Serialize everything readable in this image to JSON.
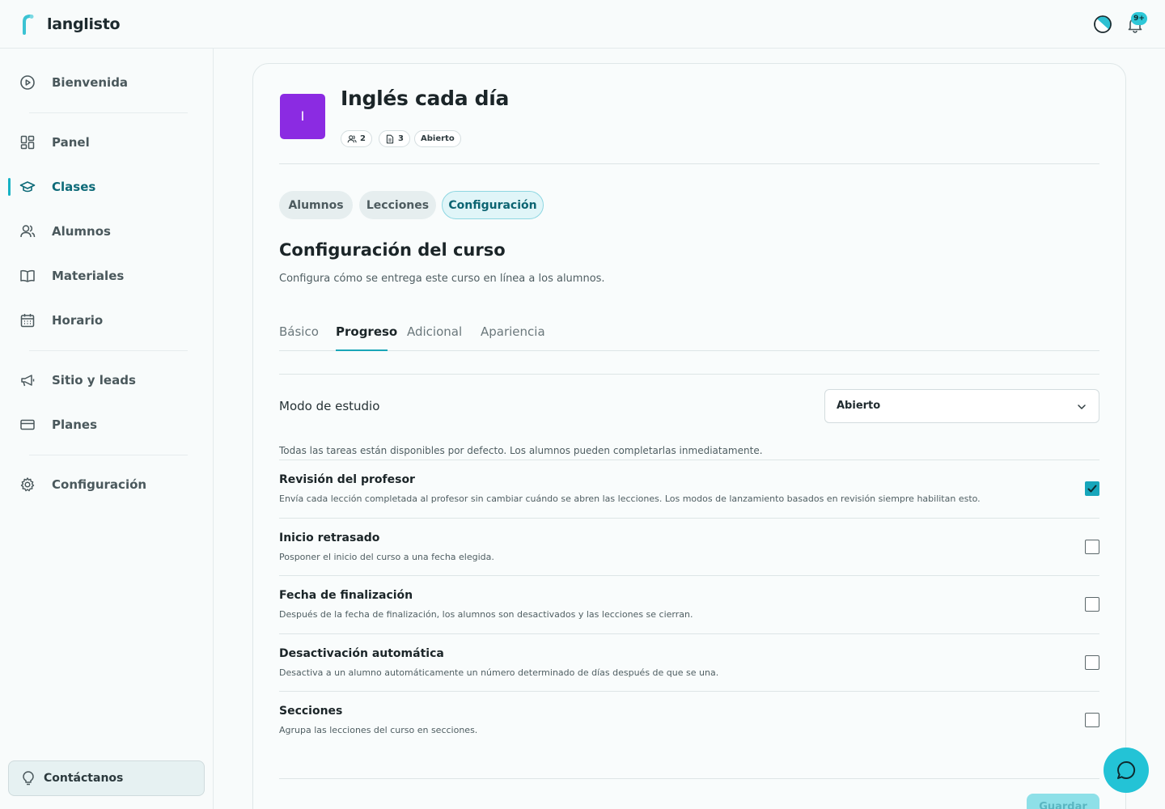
{
  "app": {
    "name": "langlisto",
    "notification_badge": "9+",
    "colors": {
      "accent": "#16b2c4",
      "avatar": "#8b2be2",
      "checkbox_on": "#17a6bb"
    }
  },
  "sidebar": {
    "items": [
      {
        "label": "Bienvenida",
        "icon": "play-circle-icon"
      },
      {
        "label": "Panel",
        "icon": "dashboard-grid-icon"
      },
      {
        "label": "Clases",
        "icon": "graduation-cap-icon",
        "active": true
      },
      {
        "label": "Alumnos",
        "icon": "users-icon"
      },
      {
        "label": "Materiales",
        "icon": "book-icon"
      },
      {
        "label": "Horario",
        "icon": "calendar-icon"
      },
      {
        "label": "Sitio y leads",
        "icon": "megaphone-icon"
      },
      {
        "label": "Planes",
        "icon": "credit-card-icon"
      },
      {
        "label": "Configuración",
        "icon": "gear-icon"
      }
    ],
    "contact_label": "Contáctanos"
  },
  "course": {
    "avatar_letter": "I",
    "title": "Inglés cada día",
    "students_count": "2",
    "lessons_count": "3",
    "status": "Abierto"
  },
  "pills": [
    {
      "label": "Alumnos"
    },
    {
      "label": "Lecciones"
    },
    {
      "label": "Configuración",
      "active": true
    }
  ],
  "settings": {
    "title": "Configuración del curso",
    "subtitle": "Configura cómo se entrega este curso en línea a los alumnos.",
    "tabs": [
      {
        "label": "Básico"
      },
      {
        "label": "Progreso",
        "active": true
      },
      {
        "label": "Adicional"
      },
      {
        "label": "Apariencia"
      }
    ],
    "study_mode_label": "Modo de estudio",
    "study_mode_value": "Abierto",
    "study_mode_hint": "Todas las tareas están disponibles por defecto. Los alumnos pueden completarlas inmediatamente.",
    "options": [
      {
        "title": "Revisión del profesor",
        "desc": "Envía cada lección completada al profesor sin cambiar cuándo se abren las lecciones. Los modos de lanzamiento basados en revisión siempre habilitan esto.",
        "checked": true
      },
      {
        "title": "Inicio retrasado",
        "desc": "Posponer el inicio del curso a una fecha elegida.",
        "checked": false
      },
      {
        "title": "Fecha de finalización",
        "desc": "Después de la fecha de finalización, los alumnos son desactivados y las lecciones se cierran.",
        "checked": false
      },
      {
        "title": "Desactivación automática",
        "desc": "Desactiva a un alumno automáticamente un número determinado de días después de que se una.",
        "checked": false
      },
      {
        "title": "Secciones",
        "desc": "Agrupa las lecciones del curso en secciones.",
        "checked": false
      }
    ],
    "save_label": "Guardar"
  }
}
